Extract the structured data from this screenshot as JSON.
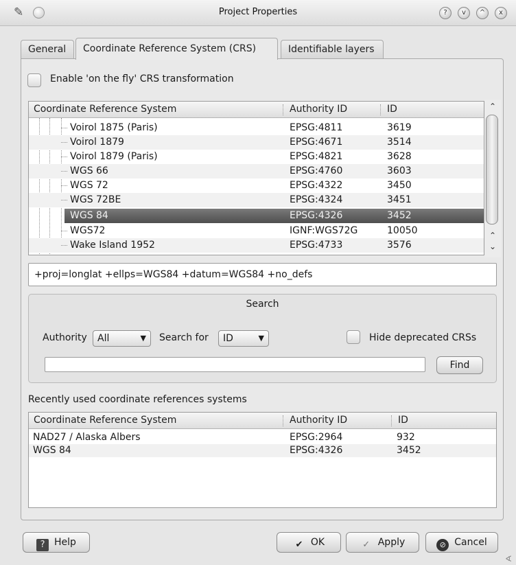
{
  "window": {
    "title": "Project Properties",
    "controls": [
      "?",
      "v",
      "^",
      "x"
    ]
  },
  "tabs": [
    {
      "label": "General",
      "active": false
    },
    {
      "label": "Coordinate Reference System (CRS)",
      "active": true
    },
    {
      "label": "Identifiable layers",
      "active": false
    }
  ],
  "otf": {
    "label": "Enable 'on the fly' CRS transformation",
    "checked": false
  },
  "crs_list": {
    "columns": [
      "Coordinate Reference System",
      "Authority ID",
      "ID"
    ],
    "rows": [
      {
        "name": "Voirol 1875 (Paris)",
        "authority": "EPSG:4811",
        "id": "3619"
      },
      {
        "name": "Voirol 1879",
        "authority": "EPSG:4671",
        "id": "3514"
      },
      {
        "name": "Voirol 1879 (Paris)",
        "authority": "EPSG:4821",
        "id": "3628"
      },
      {
        "name": "WGS 66",
        "authority": "EPSG:4760",
        "id": "3603"
      },
      {
        "name": "WGS 72",
        "authority": "EPSG:4322",
        "id": "3450"
      },
      {
        "name": "WGS 72BE",
        "authority": "EPSG:4324",
        "id": "3451"
      },
      {
        "name": "WGS 84",
        "authority": "EPSG:4326",
        "id": "3452"
      },
      {
        "name": "WGS72",
        "authority": "IGNF:WGS72G",
        "id": "10050"
      },
      {
        "name": "Wake Island 1952",
        "authority": "EPSG:4733",
        "id": "3576"
      }
    ],
    "selected_index": 6
  },
  "proj_string": "+proj=longlat +ellps=WGS84 +datum=WGS84 +no_defs",
  "search": {
    "title": "Search",
    "authority_label": "Authority",
    "authority_value": "All",
    "search_for_label": "Search for",
    "search_for_value": "ID",
    "hide_deprecated_label": "Hide deprecated CRSs",
    "hide_deprecated_checked": false,
    "query": "",
    "find_label": "Find"
  },
  "recent": {
    "label": "Recently used coordinate references systems",
    "columns": [
      "Coordinate Reference System",
      "Authority ID",
      "ID"
    ],
    "rows": [
      {
        "name": "NAD27 / Alaska Albers",
        "authority": "EPSG:2964",
        "id": "932"
      },
      {
        "name": "WGS 84",
        "authority": "EPSG:4326",
        "id": "3452"
      }
    ]
  },
  "buttons": {
    "help": "Help",
    "ok": "OK",
    "apply": "Apply",
    "cancel": "Cancel"
  },
  "icons": {
    "app": "pencil-icon",
    "help": "help-book-icon",
    "ok": "checkmark-icon",
    "apply": "checkmark-outline-icon",
    "cancel": "cancel-circle-icon"
  }
}
